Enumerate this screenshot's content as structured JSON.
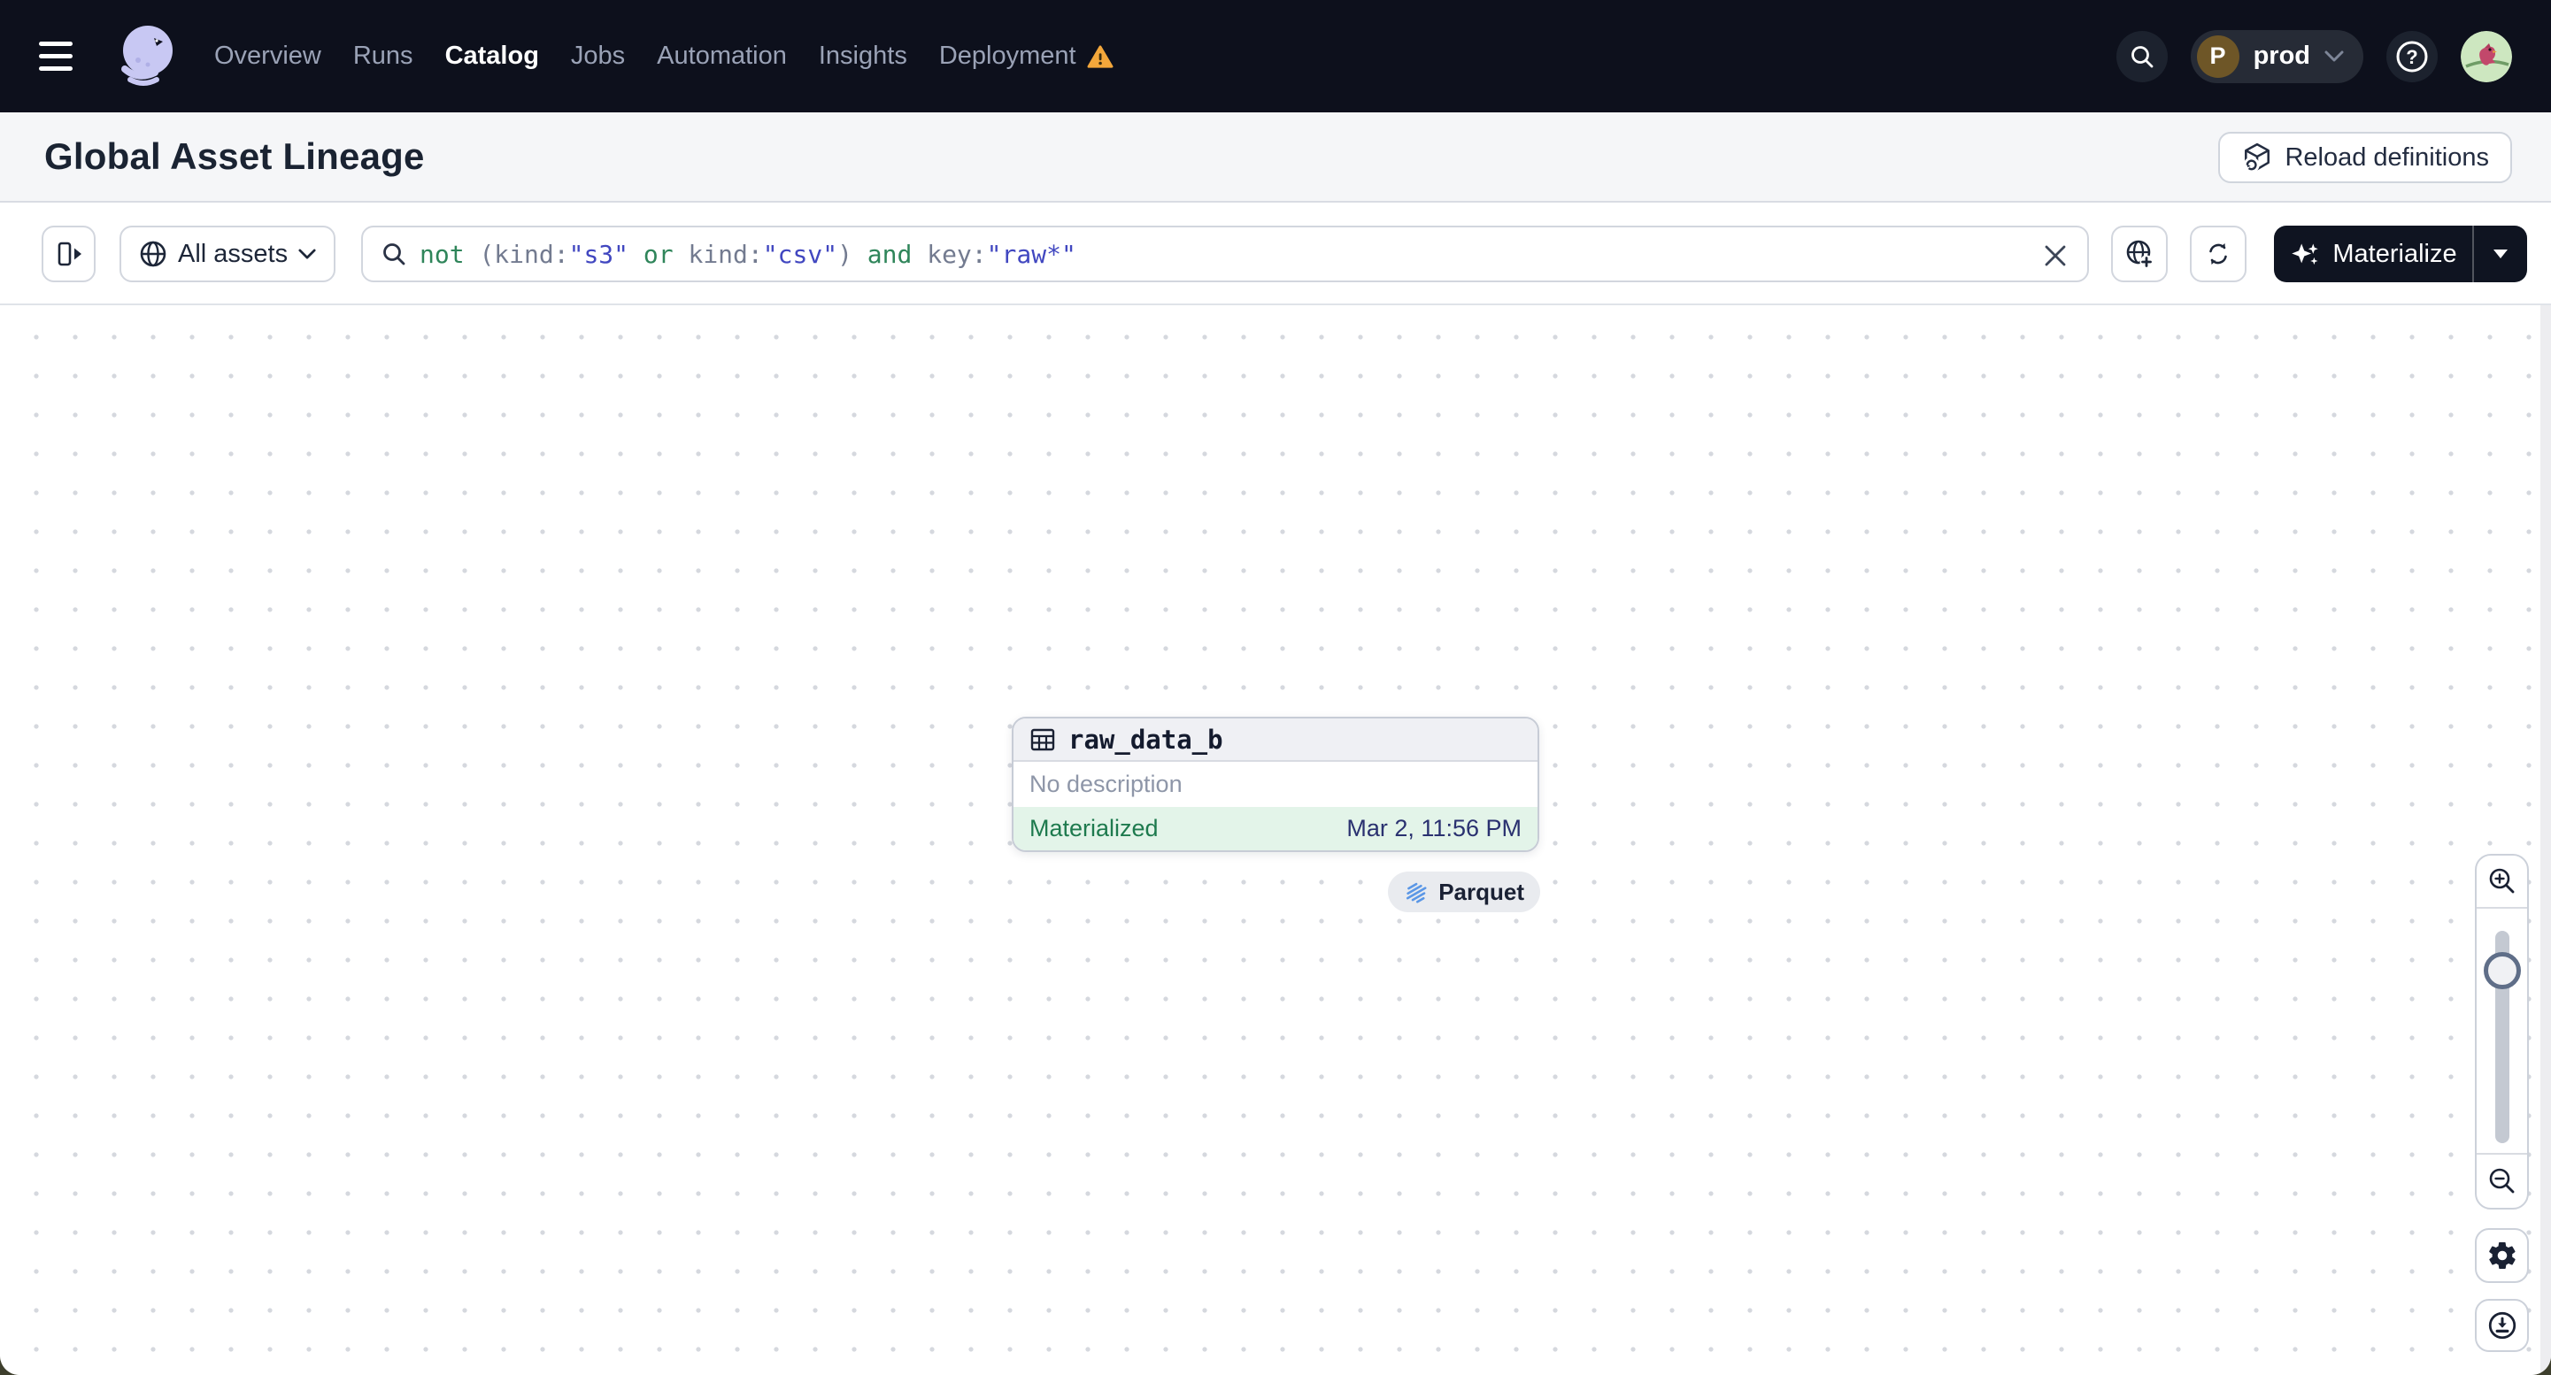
{
  "nav": {
    "items": [
      {
        "label": "Overview",
        "active": false
      },
      {
        "label": "Runs",
        "active": false
      },
      {
        "label": "Catalog",
        "active": true
      },
      {
        "label": "Jobs",
        "active": false
      },
      {
        "label": "Automation",
        "active": false
      },
      {
        "label": "Insights",
        "active": false
      },
      {
        "label": "Deployment",
        "active": false,
        "warning": true
      }
    ],
    "environment": {
      "initial": "P",
      "label": "prod"
    },
    "icons": [
      "menu-icon",
      "dagster-logo",
      "warning-icon",
      "search-icon",
      "chevron-down-icon",
      "help-icon",
      "user-avatar"
    ]
  },
  "header": {
    "title": "Global Asset Lineage",
    "reload_label": "Reload definitions"
  },
  "toolbar": {
    "scope_label": "All assets",
    "query": {
      "value": "not (kind:\"s3\" or kind:\"csv\") and key:\"raw*\"",
      "tokens": [
        {
          "t": "not ",
          "c": "op"
        },
        {
          "t": "(kind:",
          "c": "key"
        },
        {
          "t": "\"s3\"",
          "c": "val"
        },
        {
          "t": " or ",
          "c": "op"
        },
        {
          "t": "kind:",
          "c": "key"
        },
        {
          "t": "\"csv\"",
          "c": "val"
        },
        {
          "t": ")",
          "c": "key"
        },
        {
          "t": " and ",
          "c": "op"
        },
        {
          "t": "key:",
          "c": "key"
        },
        {
          "t": "\"raw*\"",
          "c": "val"
        }
      ]
    },
    "materialize_label": "Materialize",
    "icons": [
      "panel-toggle-icon",
      "globe-icon",
      "search-icon",
      "clear-icon",
      "globe-add-icon",
      "sync-icon",
      "sparkles-icon",
      "caret-down-icon"
    ]
  },
  "canvas": {
    "node": {
      "title": "raw_data_b",
      "description": "No description",
      "status": "Materialized",
      "timestamp": "Mar 2, 11:56 PM",
      "kind_tag": "Parquet"
    },
    "icons": [
      "table-icon",
      "parquet-icon",
      "zoom-in-icon",
      "zoom-out-icon",
      "gear-icon",
      "download-icon"
    ]
  },
  "colors": {
    "nav_bg": "#0d101c",
    "nav_inactive": "#9aa2b6",
    "warning_orange": "#f3a73b",
    "env_avatar_brown": "#6e5627",
    "header_bg": "#f5f6f8",
    "materialize_bg": "#0f1421",
    "status_green": "#1e7a4e",
    "status_bg_green": "#e3f4e9",
    "timestamp_navy": "#2a3170",
    "query_operator": "#2f855a",
    "query_key": "#737b90",
    "query_value": "#4147c0",
    "parquet_blue": "#5b97e6",
    "grid_dot": "#d5d8de"
  }
}
